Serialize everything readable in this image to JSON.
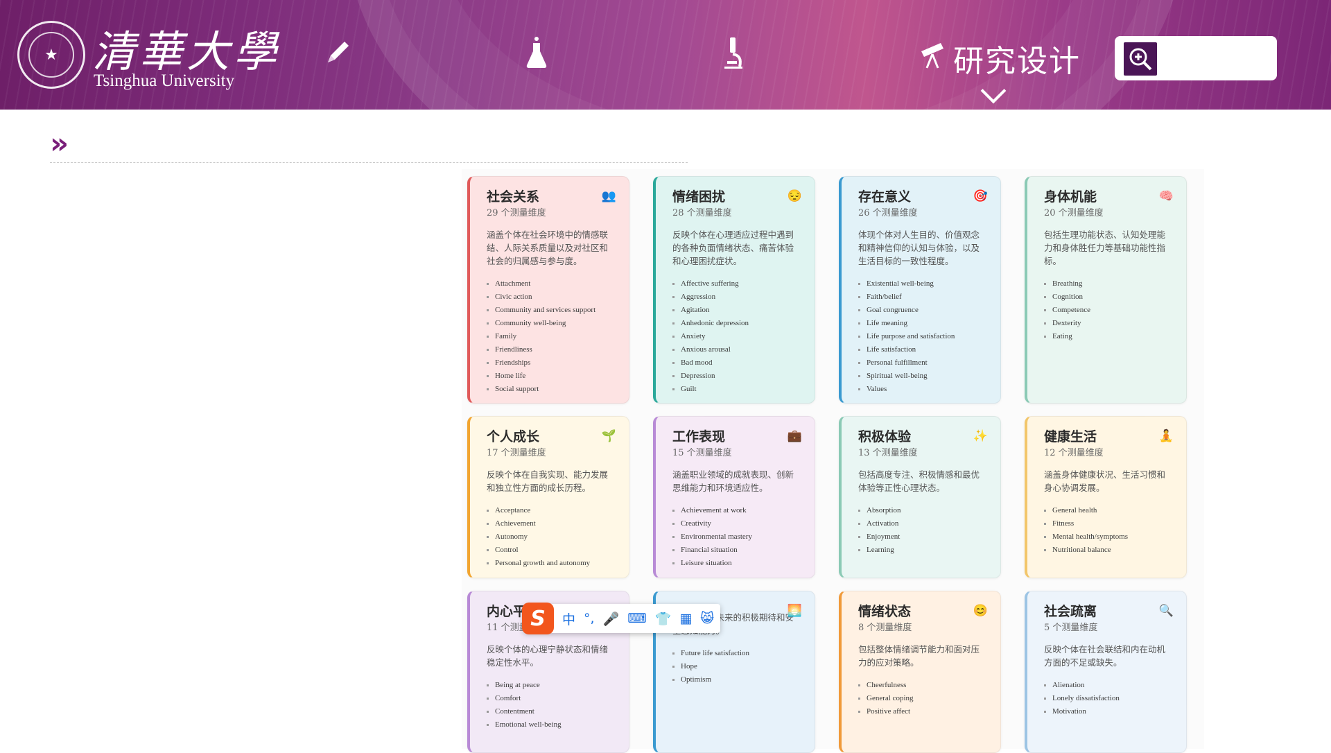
{
  "header": {
    "university_cn": "清華大學",
    "university_en": "Tsinghua University",
    "active_nav_label": "研究设计",
    "search_placeholder": ""
  },
  "nav_icons": [
    "pencil-icon",
    "flask-icon",
    "microscope-icon",
    "telescope-icon"
  ],
  "ime_toolbar": {
    "logo": "S",
    "mode": "中",
    "punct": "°,",
    "items": [
      "microphone-icon",
      "keyboard-icon",
      "shirt-icon",
      "apps-icon",
      "emoji-icon"
    ]
  },
  "cards": [
    {
      "title": "社会关系",
      "count": "29 个测量维度",
      "icon": "👥",
      "desc": "涵盖个体在社会环境中的情感联结、人际关系质量以及对社区和社会的归属感与参与度。",
      "items": [
        "Attachment",
        "Civic action",
        "Community and services support",
        "Community well-being",
        "Family",
        "Friendliness",
        "Friendships",
        "Home life",
        "Social support"
      ]
    },
    {
      "title": "情绪困扰",
      "count": "28 个测量维度",
      "icon": "😔",
      "desc": "反映个体在心理适应过程中遇到的各种负面情绪状态、痛苦体验和心理困扰症状。",
      "items": [
        "Affective suffering",
        "Aggression",
        "Agitation",
        "Anhedonic depression",
        "Anxiety",
        "Anxious arousal",
        "Bad mood",
        "Depression",
        "Guilt"
      ]
    },
    {
      "title": "存在意义",
      "count": "26 个测量维度",
      "icon": "🎯",
      "desc": "体现个体对人生目的、价值观念和精神信仰的认知与体验，以及生活目标的一致性程度。",
      "items": [
        "Existential well-being",
        "Faith/belief",
        "Goal congruence",
        "Life meaning",
        "Life purpose and satisfaction",
        "Life satisfaction",
        "Personal fulfillment",
        "Spiritual well-being",
        "Values"
      ]
    },
    {
      "title": "身体机能",
      "count": "20 个测量维度",
      "icon": "🧠",
      "desc": "包括生理功能状态、认知处理能力和身体胜任力等基础功能性指标。",
      "items": [
        "Breathing",
        "Cognition",
        "Competence",
        "Dexterity",
        "Eating"
      ]
    },
    {
      "title": "个人成长",
      "count": "17 个测量维度",
      "icon": "🌱",
      "desc": "反映个体在自我实现、能力发展和独立性方面的成长历程。",
      "items": [
        "Acceptance",
        "Achievement",
        "Autonomy",
        "Control",
        "Personal growth and autonomy"
      ]
    },
    {
      "title": "工作表现",
      "count": "15 个测量维度",
      "icon": "💼",
      "desc": "涵盖职业领域的成就表现、创新思维能力和环境适应性。",
      "items": [
        "Achievement at work",
        "Creativity",
        "Environmental mastery",
        "Financial situation",
        "Leisure situation"
      ]
    },
    {
      "title": "积极体验",
      "count": "13 个测量维度",
      "icon": "✨",
      "desc": "包括高度专注、积极情感和最优体验等正性心理状态。",
      "items": [
        "Absorption",
        "Activation",
        "Enjoyment",
        "Learning"
      ]
    },
    {
      "title": "健康生活",
      "count": "12 个测量维度",
      "icon": "🧘",
      "desc": "涵盖身体健康状况、生活习惯和身心协调发展。",
      "items": [
        "General health",
        "Fitness",
        "Mental health/symptoms",
        "Nutritional balance"
      ]
    },
    {
      "title": "内心平",
      "count": "11 个测量维",
      "icon": "",
      "desc": "反映个体的心理宁静状态和情绪稳定性水平。",
      "items": [
        "Being at peace",
        "Comfort",
        "Contentment",
        "Emotional well-being"
      ]
    },
    {
      "title": "",
      "count": "",
      "icon": "🌅",
      "desc": "体现个体对未来的积极期待和安全感知能力。",
      "items": [
        "Future life satisfaction",
        "Hope",
        "Optimism"
      ]
    },
    {
      "title": "情绪状态",
      "count": "8 个测量维度",
      "icon": "😊",
      "desc": "包括整体情绪调节能力和面对压力的应对策略。",
      "items": [
        "Cheerfulness",
        "General coping",
        "Positive affect"
      ]
    },
    {
      "title": "社会疏离",
      "count": "5 个测量维度",
      "icon": "🔍",
      "desc": "反映个体在社会联结和内在动机方面的不足或缺失。",
      "items": [
        "Alienation",
        "Lonely dissatisfaction",
        "Motivation"
      ]
    }
  ],
  "colors": {
    "header_purple": "#7b2676",
    "accent_purple": "#7a1f7a",
    "card_red": "#e05a5a",
    "card_teal": "#2aa89a",
    "card_blue": "#3a9ad0",
    "card_green": "#8bcab5",
    "card_orange": "#f2a530",
    "card_purple": "#b88ad6"
  }
}
